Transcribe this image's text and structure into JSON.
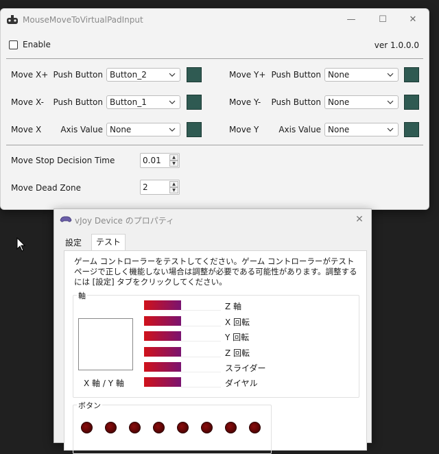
{
  "window1": {
    "title": "MouseMoveToVirtualPadInput",
    "enable_label": "Enable",
    "version": "ver 1.0.0.0",
    "rows": [
      {
        "left_label": "Move X+",
        "left_type": "Push Button",
        "left_value": "Button_2",
        "right_label": "Move Y+",
        "right_type": "Push Button",
        "right_value": "None"
      },
      {
        "left_label": "Move X-",
        "left_type": "Push Button",
        "left_value": "Button_1",
        "right_label": "Move Y-",
        "right_type": "Push Button",
        "right_value": "None"
      },
      {
        "left_label": "Move X",
        "left_type": "Axis Value",
        "left_value": "None",
        "right_label": "Move Y",
        "right_type": "Axis Value",
        "right_value": "None"
      }
    ],
    "stop_time_label": "Move Stop Decision Time",
    "stop_time_value": "0.01",
    "dead_zone_label": "Move Dead Zone",
    "dead_zone_value": "2",
    "swatch_color": "#2f5a52"
  },
  "window2": {
    "title": "vJoy Device のプロパティ",
    "tabs": [
      "設定",
      "テスト"
    ],
    "active_tab": "テスト",
    "description": "ゲーム コントローラーをテストしてください。ゲーム コントローラーがテスト ページで正しく機能しない場合は調整が必要である可能性があります。調整するには [設定] タブをクリックしてください。",
    "axes_group_title": "軸",
    "xy_label": "X 軸 / Y 軸",
    "axes": [
      "Z 軸",
      "X 回転",
      "Y 回転",
      "Z 回転",
      "スライダー",
      "ダイヤル"
    ],
    "buttons_group_title": "ボタン",
    "button_count_visible": 8
  }
}
